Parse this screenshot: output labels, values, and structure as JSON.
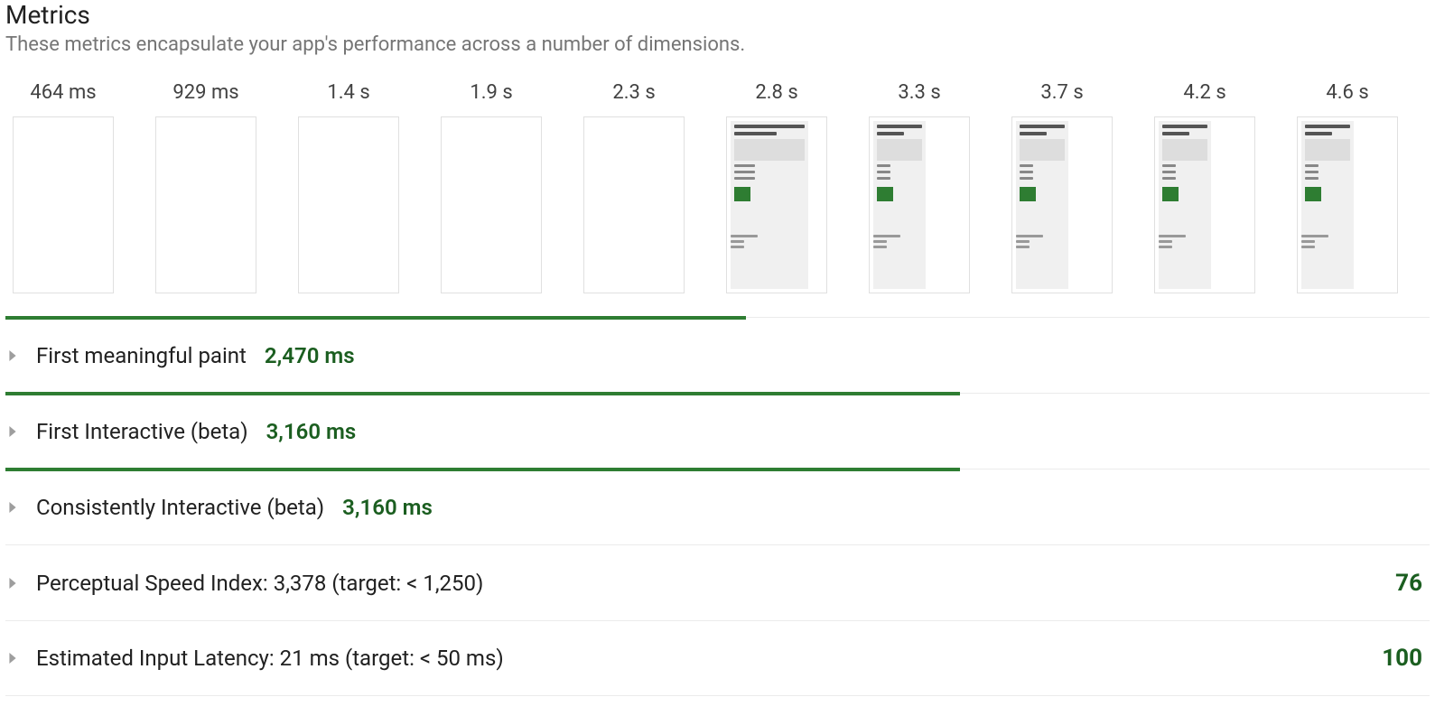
{
  "header": {
    "title": "Metrics",
    "subtitle": "These metrics encapsulate your app's performance across a number of dimensions."
  },
  "filmstrip": {
    "times": [
      "464 ms",
      "929 ms",
      "1.4 s",
      "1.9 s",
      "2.3 s",
      "2.8 s",
      "3.3 s",
      "3.7 s",
      "4.2 s",
      "4.6 s"
    ],
    "first_loaded_index": 5
  },
  "metrics": [
    {
      "label": "First meaningful paint",
      "value": "2,470 ms",
      "bar_percent": 52,
      "show_bar": true,
      "show_value": true
    },
    {
      "label": "First Interactive (beta)",
      "value": "3,160 ms",
      "bar_percent": 67,
      "show_bar": true,
      "show_value": true
    },
    {
      "label": "Consistently Interactive (beta)",
      "value": "3,160 ms",
      "bar_percent": 67,
      "show_bar": true,
      "show_value": true
    },
    {
      "label": "Perceptual Speed Index: 3,378 (target: < 1,250)",
      "score": "76",
      "show_bar": false,
      "show_value": false
    },
    {
      "label": "Estimated Input Latency: 21 ms (target: < 50 ms)",
      "score": "100",
      "show_bar": false,
      "show_value": false
    }
  ]
}
